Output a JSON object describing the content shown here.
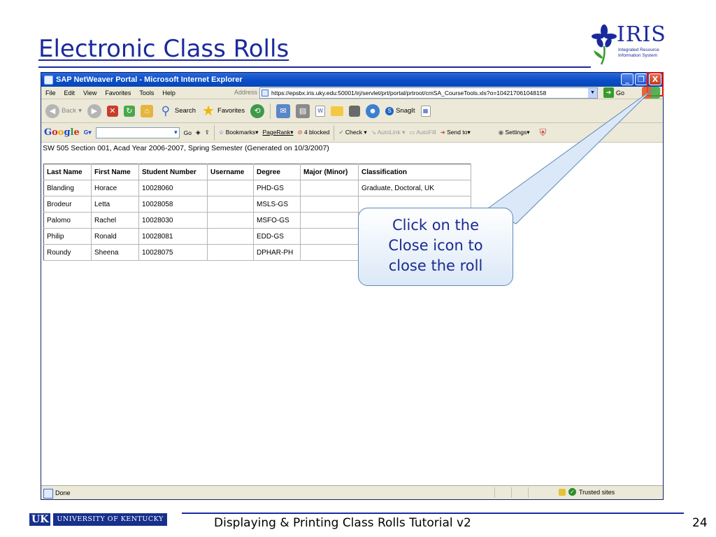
{
  "slide": {
    "title": "Electronic Class Rolls",
    "logo": {
      "word": "IRIS",
      "subtitle_line1": "Integrated Resource",
      "subtitle_line2": "Information System"
    },
    "footer": {
      "university_mark": "UK",
      "university_name": "UNIVERSITY OF KENTUCKY",
      "tutorial_title": "Displaying & Printing Class Rolls Tutorial v2",
      "page_number": "24"
    }
  },
  "browser": {
    "window_title": "SAP NetWeaver Portal - Microsoft Internet Explorer",
    "window_buttons": {
      "minimize": "_",
      "restore": "❐",
      "close": "X"
    },
    "menu": [
      "File",
      "Edit",
      "View",
      "Favorites",
      "Tools",
      "Help"
    ],
    "address_label": "Address",
    "address_value": "https://epsbx.iris.uky.edu:50001/irj/servlet/prt/portal/prtroot/cmSA_CourseTools.xls?o=104217061048158",
    "go_label": "Go",
    "toolbar": {
      "back": "Back",
      "search": "Search",
      "favorites": "Favorites",
      "snagit": "SnagIt"
    },
    "google_bar": {
      "logo": "Google",
      "go": "Go",
      "bookmarks": "Bookmarks",
      "pagerank": "PageRank",
      "blocked": "4 blocked",
      "check": "Check",
      "autolink": "AutoLink",
      "autofill": "AutoFill",
      "send_to": "Send to",
      "settings": "Settings"
    },
    "status": {
      "left": "Done",
      "zone": "Trusted sites"
    }
  },
  "roll": {
    "caption": "SW 505 Section 001, Acad Year 2006-2007, Spring Semester (Generated on 10/3/2007)",
    "columns": [
      "Last Name",
      "First Name",
      "Student Number",
      "Username",
      "Degree",
      "Major (Minor)",
      "Classification"
    ],
    "rows": [
      [
        "Blanding",
        "Horace",
        "10028060",
        "",
        "PHD-GS",
        "",
        "Graduate, Doctoral, UK"
      ],
      [
        "Brodeur",
        "Letta",
        "10028058",
        "",
        "MSLS-GS",
        "",
        ""
      ],
      [
        "Palomo",
        "Rachel",
        "10028030",
        "",
        "MSFO-GS",
        "",
        ""
      ],
      [
        "Philip",
        "Ronald",
        "10028081",
        "",
        "EDD-GS",
        "",
        ""
      ],
      [
        "Roundy",
        "Sheena",
        "10028075",
        "",
        "DPHAR-PH",
        "",
        ""
      ]
    ]
  },
  "callout": {
    "line1": "Click on the",
    "line2": "Close icon to",
    "line3": "close the roll"
  },
  "colors": {
    "title_blue": "#1a2a9c",
    "xp_title": "#0a50c8",
    "close_red": "#c6381a",
    "highlight_red": "#e01010"
  }
}
